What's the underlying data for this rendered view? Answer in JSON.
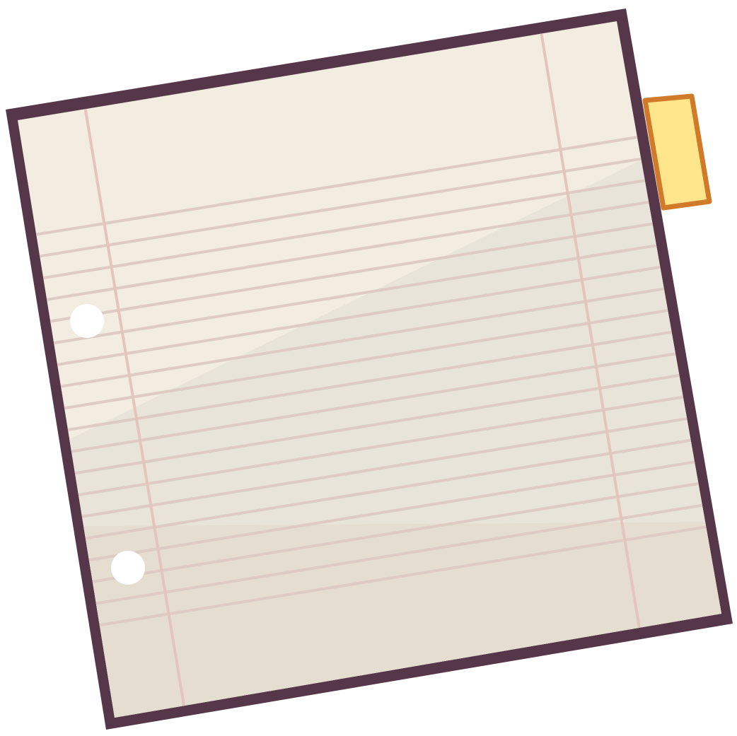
{
  "icon": {
    "name": "notepad-paper-icon",
    "colors": {
      "border": "#56374A",
      "paper_top": "#F2ECE1",
      "paper_middle": "#E8E4D9",
      "paper_bottom": "#E5DDD0",
      "rule_line": "#DDCBC4",
      "margin_line": "#E6C4BE",
      "hole": "#FFFFFF",
      "tab_fill": "#FFE68C",
      "tab_stroke": "#D07A2A"
    },
    "rule_line_count": 19,
    "hole_count": 2
  }
}
